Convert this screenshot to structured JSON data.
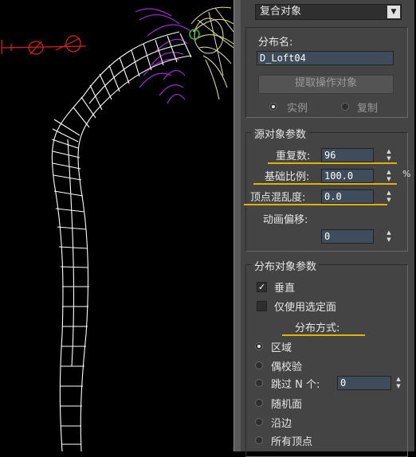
{
  "type_dropdown": {
    "value": "复合对象"
  },
  "distribution_name": {
    "label": "分布名:",
    "value": "D_Loft04"
  },
  "pick_button": {
    "label": "提取操作对象"
  },
  "mode": {
    "instance": "实例",
    "copy": "复制"
  },
  "source_params": {
    "title": "源对象参数",
    "duplicates": {
      "label": "重复数:",
      "value": "96"
    },
    "base_scale": {
      "label": "基础比例:",
      "value": "100.0"
    },
    "vertex_chaos": {
      "label": "顶点混乱度:",
      "value": "0.0"
    },
    "anim_offset": {
      "label": "动画偏移:",
      "value": "0"
    },
    "side_mark": "%"
  },
  "distrib_params": {
    "title": "分布对象参数",
    "perpendicular": {
      "label": "垂直",
      "checked": true
    },
    "selected_faces": {
      "label": "仅使用选定面",
      "checked": false
    },
    "method_label": "分布方式:",
    "area": "区域",
    "even": "偶校验",
    "skip_n": {
      "label": "跳过 N 个:",
      "value": "0"
    },
    "random_faces": "随机面",
    "along_edges": "沿边",
    "all_vertices": "所有顶点"
  },
  "colors": {
    "wire_white": "#ffffff",
    "wire_purple": "#9b2fd0",
    "wire_yellow": "#e6e6a0",
    "wire_red": "#e02020",
    "panel_bg": "#444444",
    "highlight_underline": "#e3b200"
  }
}
